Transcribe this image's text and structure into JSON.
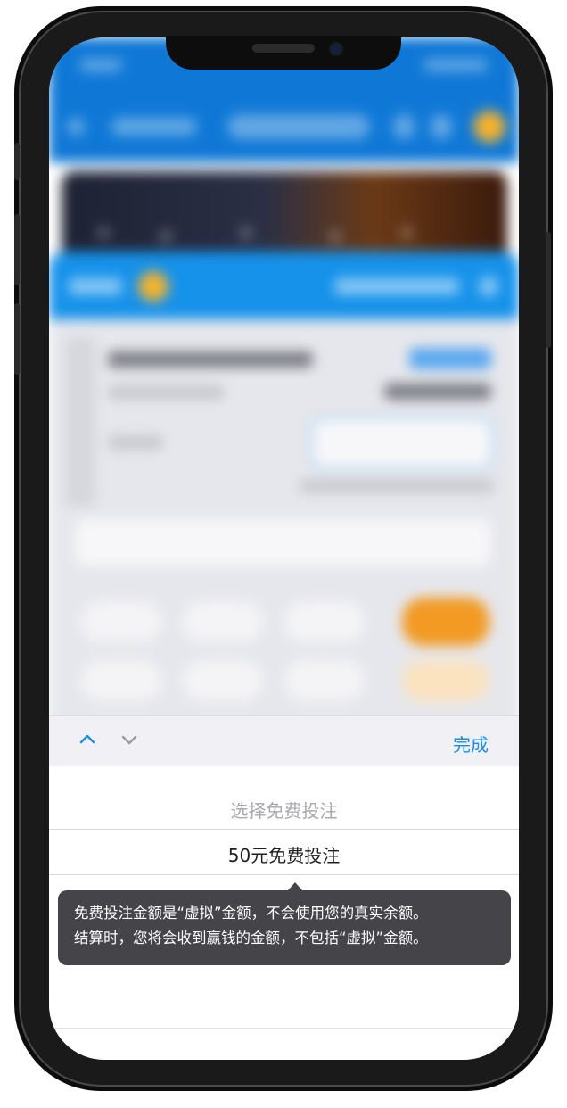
{
  "toolbar": {
    "prev_icon": "chevron-up-icon",
    "next_icon": "chevron-down-icon",
    "done_label": "完成",
    "accent_color": "#1a8de3"
  },
  "picker": {
    "options": [
      {
        "label": "选择免费投注"
      },
      {
        "label": "50元免费投注"
      }
    ],
    "selected_index": 1
  },
  "tooltip": {
    "line1": "免费投注金额是“虚拟”金额，不会使用您的真实余额。",
    "line2": "结算时，您将会收到赢钱的金额，不包括“虚拟”金额。"
  },
  "colors": {
    "brand_blue": "#0f78d6",
    "tooltip_bg": "#454549",
    "orange": "#f29a24"
  }
}
